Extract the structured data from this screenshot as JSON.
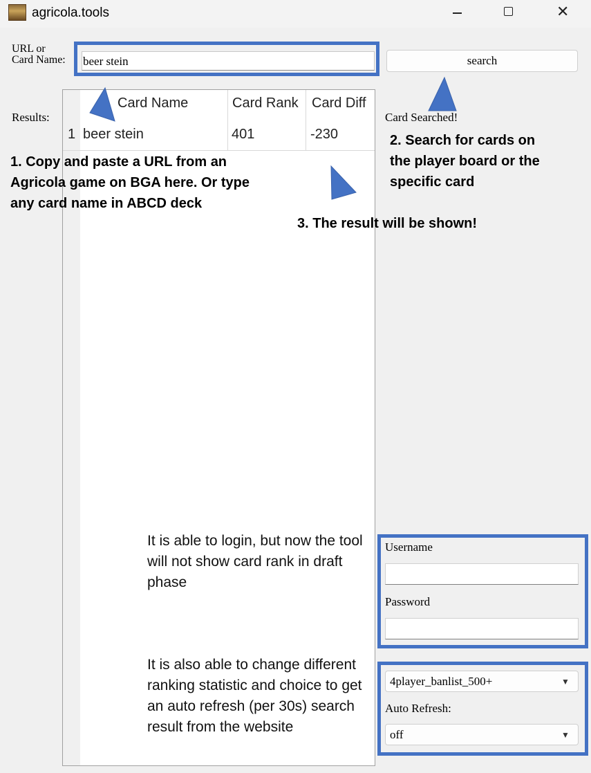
{
  "window": {
    "title": "agricola.tools",
    "icon": "app-logo-icon",
    "controls": [
      "minimize-icon",
      "maximize-icon",
      "close-icon"
    ]
  },
  "search": {
    "label_line1": "URL or",
    "label_line2": "Card Name:",
    "value": "beer stein",
    "button_label": "search"
  },
  "results": {
    "label": "Results:",
    "columns": [
      "Card Name",
      "Card Rank",
      "Card Diff"
    ],
    "rows": [
      {
        "index": "1",
        "name": "beer stein",
        "rank": "401",
        "diff": "-230"
      }
    ]
  },
  "status": "Card Searched!",
  "login": {
    "username_label": "Username",
    "username_value": "",
    "password_label": "Password",
    "password_value": ""
  },
  "options": {
    "ranking_selected": "4player_banlist_500+",
    "auto_refresh_label": "Auto Refresh:",
    "auto_refresh_selected": "off"
  },
  "annotations": {
    "note1": "1. Copy and paste a URL from an Agricola game on BGA here. Or type any card name in ABCD deck",
    "note2": "2. Search for cards on the player board or the specific card",
    "note3": "3. The result will be shown!",
    "login_info": "It is able to login, but now the tool will not show card rank in draft phase",
    "ranking_info": "It is also able to change different ranking statistic and choice to get an auto refresh (per 30s) search result from the website"
  },
  "colors": {
    "highlight": "#4472c4",
    "arrow": "#4472c4",
    "window_bg": "#f0f0f0"
  }
}
